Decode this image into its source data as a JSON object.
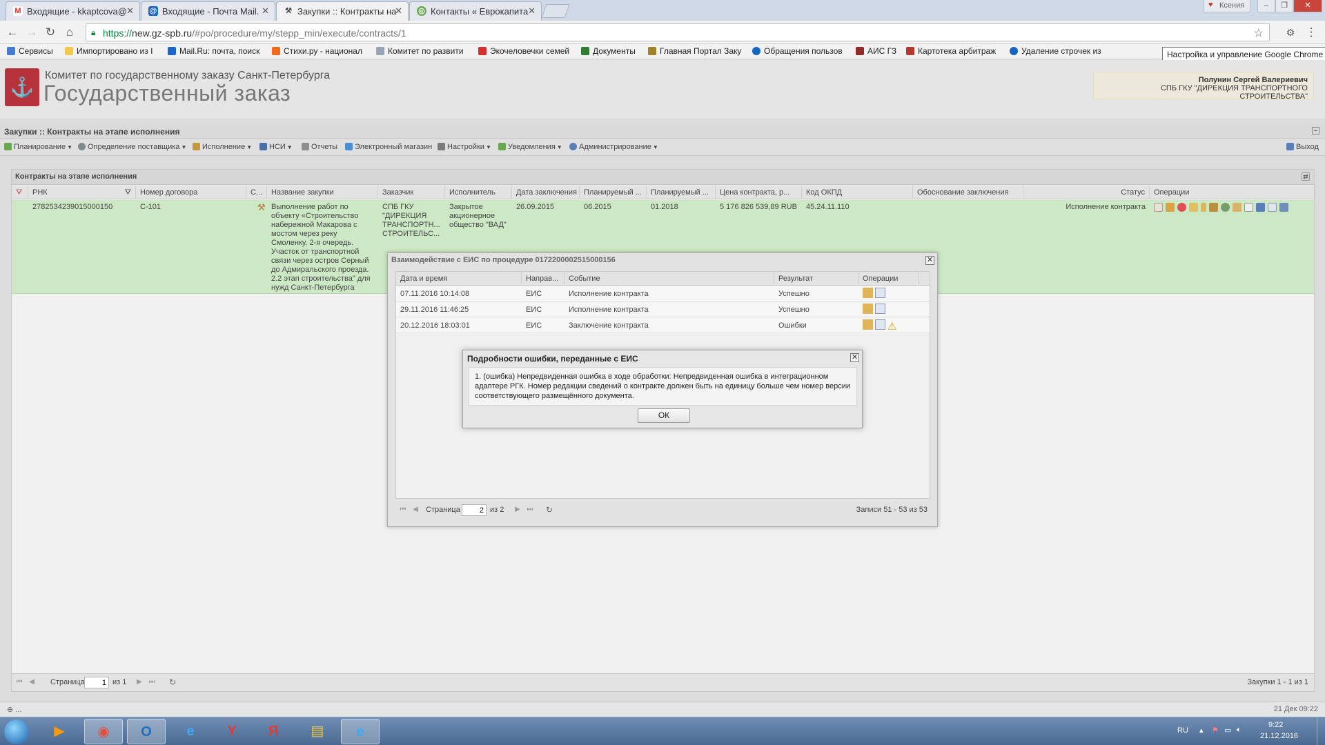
{
  "browser": {
    "tabs": [
      {
        "label": "Входящие - kkaptcova@",
        "icon": "gmail-icon",
        "active": false
      },
      {
        "label": "Входящие - Почта Mail.",
        "icon": "mailru-icon",
        "active": false
      },
      {
        "label": "Закупки :: Контракты на",
        "icon": "gz-app-icon",
        "active": true
      },
      {
        "label": "Контакты « Еврокапита",
        "icon": "site-icon",
        "active": false
      }
    ],
    "profile_name": "Ксения",
    "url_scheme": "https://",
    "url_host": "new.gz-spb.ru",
    "url_path": "/#po/procedure/my/stepp_min/execute/contracts/1",
    "tooltip": "Настройка и управление Google Chrome",
    "bookmarks": [
      {
        "label": "Сервисы",
        "color": "#4a7bd2"
      },
      {
        "label": "Импортировано из I",
        "color": "#f2c94c"
      },
      {
        "label": "Mail.Ru: почта, поиск",
        "color": "#1b66c9"
      },
      {
        "label": "Стихи.ру - национал",
        "color": "#f26b1d"
      },
      {
        "label": "Комитет по развити",
        "color": "#9aa3b5"
      },
      {
        "label": "Экочеловечки семей",
        "color": "#d32f2f"
      },
      {
        "label": "Документы",
        "color": "#2e7d32"
      },
      {
        "label": "Главная Портал Заку",
        "color": "#a0822c"
      },
      {
        "label": "Обращения пользов",
        "color": "#1565c0"
      },
      {
        "label": "АИС ГЗ",
        "color": "#8e2a2a"
      },
      {
        "label": "Картотека арбитраж",
        "color": "#b23a2f"
      },
      {
        "label": "Удаление строчек из",
        "color": "#1565c0"
      }
    ]
  },
  "app": {
    "org_name": "Комитет по государственному заказу Санкт-Петербурга",
    "app_name": "Государственный заказ",
    "user_name": "Полунин Сергей Валериевич",
    "user_org": "СПБ ГКУ \"ДИРЕКЦИЯ ТРАНСПОРТНОГО СТРОИТЕЛЬСТВА\"",
    "section_title": "Закупки :: Контракты на этапе исполнения",
    "menu": [
      {
        "label": "Планирование",
        "dropdown": true,
        "color": "#6aa84f"
      },
      {
        "label": "Определение поставщика",
        "dropdown": true,
        "color": "#7f8c8d"
      },
      {
        "label": "Исполнение",
        "dropdown": true,
        "color": "#c49a3c"
      },
      {
        "label": "НСИ",
        "dropdown": true,
        "color": "#4a6fa5"
      },
      {
        "label": "Отчеты",
        "dropdown": false,
        "color": "#8e8e8e"
      },
      {
        "label": "Электронный магазин",
        "dropdown": false,
        "color": "#4a8fd6"
      },
      {
        "label": "Настройки",
        "dropdown": true,
        "color": "#7a7a7a"
      },
      {
        "label": "Уведомления",
        "dropdown": true,
        "color": "#6aa84f"
      },
      {
        "label": "Администрирование",
        "dropdown": true,
        "color": "#5b7fb5"
      }
    ],
    "exit_label": "Выход"
  },
  "grid": {
    "title": "Контракты на этапе исполнения",
    "columns": [
      "РНК",
      "Номер договора",
      "С...",
      "Название закупки",
      "Заказчик",
      "Исполнитель",
      "Дата заключения",
      "Планируемый ...",
      "Планируемый ...",
      "Цена контракта, р...",
      "Код ОКПД",
      "Обоснование заключения",
      "Статус",
      "Операции"
    ],
    "row": {
      "rnk": "2782534239015000150",
      "contract_no": "С-101",
      "title": "Выполнение работ по объекту «Строительство набережной Макарова с мостом через реку Смоленку. 2-я очередь. Участок от транспортной связи через остров Серный до Адмиральского проезда. 2.2 этап строительства\" для нужд Санкт-Петербурга",
      "customer": "СПБ ГКУ \"ДИРЕКЦИЯ ТРАНСПОРТН... СТРОИТЕЛЬС...",
      "executor": "Закрытое акционерное общество \"ВАД\"",
      "date_signed": "26.09.2015",
      "planned_1": "06.2015",
      "planned_2": "01.2018",
      "price": "5 176 826 539,89 RUB",
      "okpd": "45.24.11.110",
      "basis": "",
      "status": "Исполнение контракта"
    },
    "pager": {
      "page_label": "Страница",
      "page": "1",
      "of_label": "из 1",
      "summary": "Закупки 1 - 1 из 1"
    }
  },
  "eis_dialog": {
    "title": "Взаимодействие с ЕИС по процедуре 0172200002515000156",
    "columns": [
      "Дата и время",
      "Направ...",
      "Событие",
      "Результат",
      "Операции"
    ],
    "rows": [
      {
        "datetime": "07.11.2016 10:14:08",
        "direction": "ЕИС",
        "event": "Исполнение контракта",
        "result": "Успешно",
        "warning": false
      },
      {
        "datetime": "29.11.2016 11:46:25",
        "direction": "ЕИС",
        "event": "Исполнение контракта",
        "result": "Успешно",
        "warning": false
      },
      {
        "datetime": "20.12.2016 18:03:01",
        "direction": "ЕИС",
        "event": "Заключение контракта",
        "result": "Ошибки",
        "warning": true
      }
    ],
    "pager": {
      "page_label": "Страница",
      "page": "2",
      "of_label": "из 2",
      "summary": "Записи 51 - 53 из 53"
    }
  },
  "error_dialog": {
    "title": "Подробности ошибки, переданные с ЕИС",
    "message": "1. (ошибка) Непредвиденная ошибка в ходе обработки: Непредвиденная ошибка в интеграционном адаптере РГК. Номер редакции сведений о контракте должен быть на единицу больше чем номер версии соответствующего размещённого документа.",
    "ok_label": "ОК"
  },
  "status_left": "⊕ ...",
  "status_right": "21 Дек 09:22",
  "taskbar": {
    "lang": "RU",
    "time": "9:22",
    "date": "21.12.2016"
  }
}
